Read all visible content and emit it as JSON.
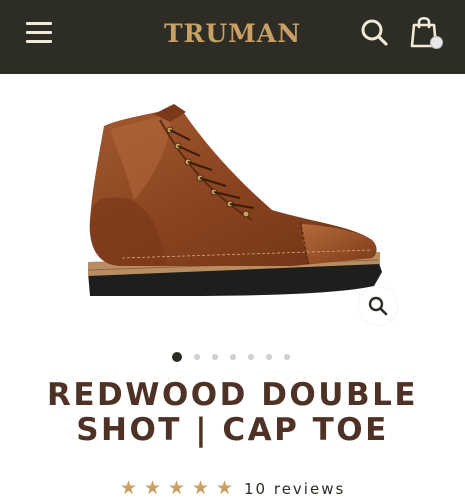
{
  "header": {
    "logo": "TRUMAN",
    "menu_icon": "hamburger-menu-icon",
    "search_icon": "search-icon",
    "cart_icon": "shopping-bag-icon",
    "background": "#2d2d25",
    "logo_color": "#c8a063"
  },
  "gallery": {
    "image_alt": "Redwood Double Shot Cap Toe boot",
    "zoom_icon": "zoom-icon",
    "dot_count": 7,
    "active_index": 0
  },
  "product": {
    "title": "REDWOOD DOUBLE SHOT | CAP TOE",
    "rating": 5,
    "review_text": "10 reviews",
    "title_color": "#4e3226",
    "star_color": "#c8a063"
  }
}
